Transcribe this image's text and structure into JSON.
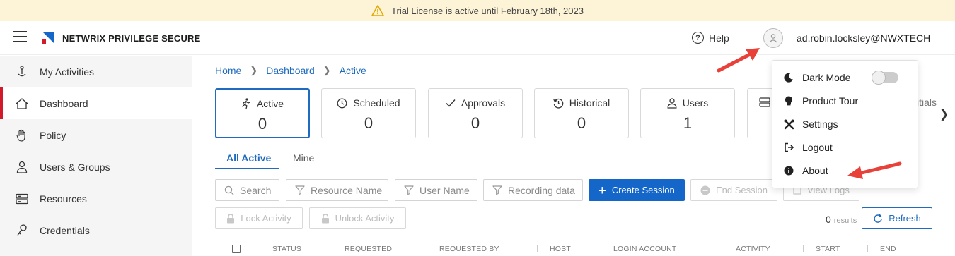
{
  "banner": {
    "text": "Trial License is active until February 18th, 2023",
    "icon": "warning-icon"
  },
  "header": {
    "brand": "NETWRIX PRIVILEGE SECURE",
    "help_label": "Help",
    "username": "ad.robin.locksley@NWXTECH"
  },
  "sidebar": {
    "items": [
      {
        "label": "My Activities",
        "icon": "activities-icon"
      },
      {
        "label": "Dashboard",
        "icon": "home-icon"
      },
      {
        "label": "Policy",
        "icon": "hand-icon"
      },
      {
        "label": "Users & Groups",
        "icon": "user-icon"
      },
      {
        "label": "Resources",
        "icon": "server-icon"
      },
      {
        "label": "Credentials",
        "icon": "key-icon"
      }
    ]
  },
  "breadcrumb": {
    "items": [
      "Home",
      "Dashboard",
      "Active"
    ]
  },
  "cards": [
    {
      "label": "Active",
      "value": "0"
    },
    {
      "label": "Scheduled",
      "value": "0"
    },
    {
      "label": "Approvals",
      "value": "0"
    },
    {
      "label": "Historical",
      "value": "0"
    },
    {
      "label": "Users",
      "value": "1"
    }
  ],
  "card_partial_label": "itials",
  "tabs": [
    "All Active",
    "Mine"
  ],
  "filters": {
    "search": "Search",
    "resource_name": "Resource Name",
    "user_name": "User Name",
    "recording_data": "Recording data"
  },
  "actions": {
    "create_session": "Create Session",
    "end_session": "End Session",
    "view_logs": "View Logs",
    "lock_activity": "Lock Activity",
    "unlock_activity": "Unlock Activity",
    "refresh": "Refresh"
  },
  "results": {
    "count": "0",
    "label": "results"
  },
  "table": {
    "columns": [
      "STATUS",
      "REQUESTED",
      "REQUESTED BY",
      "HOST",
      "LOGIN ACCOUNT",
      "ACTIVITY",
      "START",
      "END"
    ]
  },
  "user_menu": {
    "items": [
      {
        "label": "Dark Mode",
        "icon": "moon-icon"
      },
      {
        "label": "Product Tour",
        "icon": "bulb-icon"
      },
      {
        "label": "Settings",
        "icon": "tools-icon"
      },
      {
        "label": "Logout",
        "icon": "logout-icon"
      },
      {
        "label": "About",
        "icon": "info-icon"
      }
    ],
    "dark_mode_on": false
  },
  "colors": {
    "accent": "#1f6bbf",
    "primary_button": "#1466c8",
    "active_marker": "#d11a2a",
    "banner_bg": "#fdf3d7",
    "annotation_arrow": "#e8413a"
  }
}
